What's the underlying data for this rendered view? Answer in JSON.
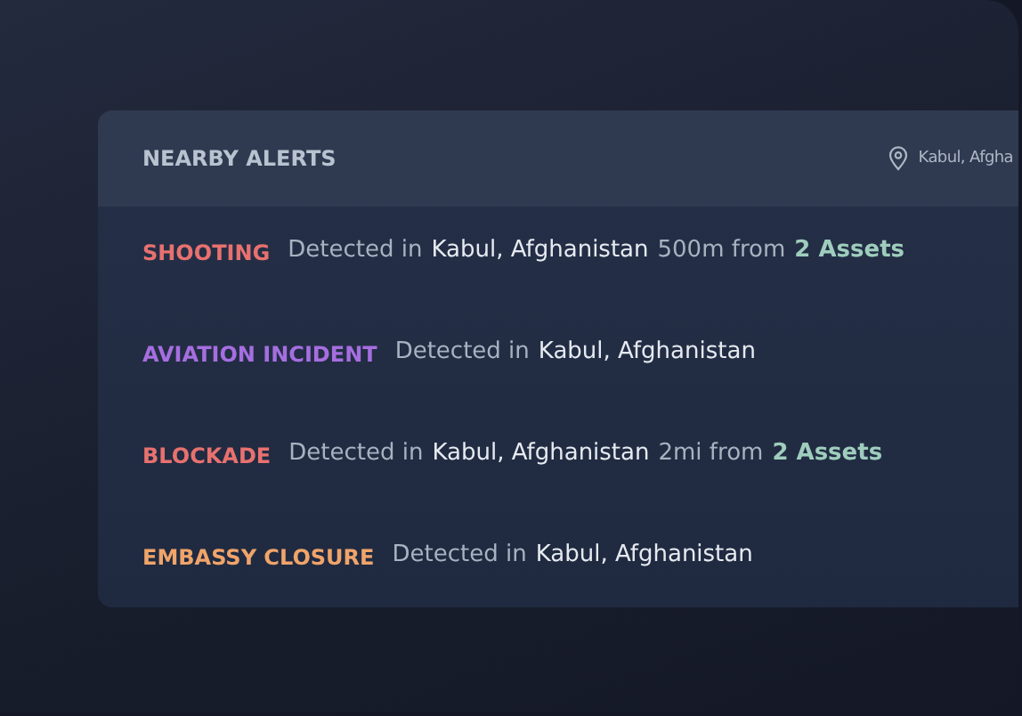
{
  "panel": {
    "title": "NEARBY ALERTS",
    "location": "Kabul, Afgha"
  },
  "alerts": [
    {
      "type": "SHOOTING",
      "color": "#e8716f",
      "detected": "Detected in",
      "location": "Kabul, Afghanistan",
      "distance": "500m from",
      "assets": "2 Assets"
    },
    {
      "type": "AVIATION INCIDENT",
      "color": "#a66ee0",
      "detected": "Detected in",
      "location": "Kabul, Afghanistan"
    },
    {
      "type": "BLOCKADE",
      "color": "#e8716f",
      "detected": "Detected in",
      "location": "Kabul, Afghanistan",
      "distance": "2mi from",
      "assets": "2 Assets"
    },
    {
      "type": "EMBASSY CLOSURE",
      "color": "#f0a46a",
      "detected": "Detected in",
      "location": "Kabul, Afghanistan"
    }
  ]
}
